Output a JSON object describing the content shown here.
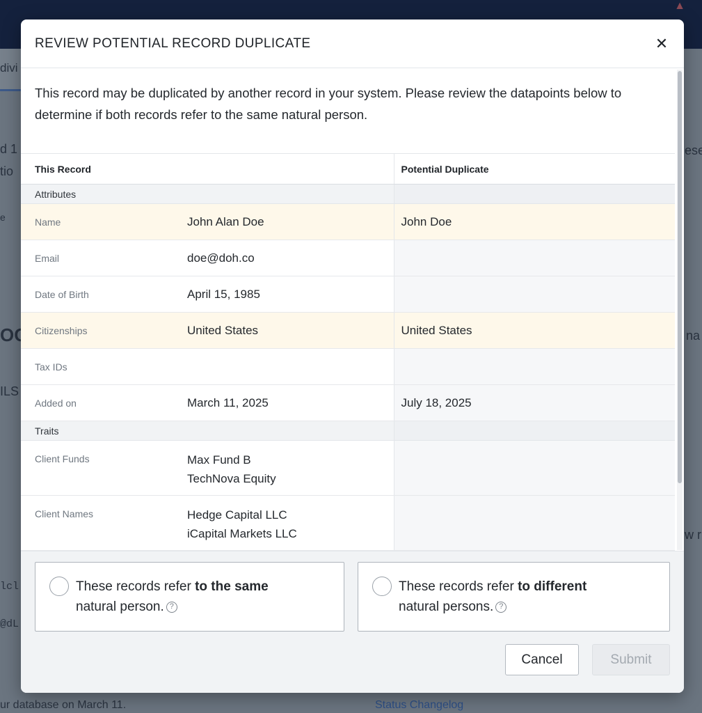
{
  "background": {
    "alert_icon": "warning-icon",
    "fragments": {
      "tab": "divi",
      "summary_1a": "d 1",
      "summary_1b": "tio",
      "right_cut_1": "ese",
      "left_cut_e": "e",
      "big_initials": "OO",
      "right_cut_2": "na",
      "section_cut": "ILS",
      "right_cut_3": "w r",
      "code_1": "lcl",
      "code_2": "@dL",
      "bottom_note": "ur database on March 11.",
      "status_changelog": "Status Changelog"
    }
  },
  "modal": {
    "title": "REVIEW POTENTIAL RECORD DUPLICATE",
    "close_icon": "close-icon",
    "intro": "This record may be duplicated by another record in your system. Please review the datapoints below to determine if both records refer to the same natural person.",
    "table": {
      "this_record_header": "This Record",
      "duplicate_header": "Potential Duplicate",
      "sections": {
        "attributes": "Attributes",
        "traits": "Traits"
      },
      "rows": [
        {
          "label": "Name",
          "this": "John Alan Doe",
          "dup": "John Doe",
          "match": true
        },
        {
          "label": "Email",
          "this": "doe@doh.co",
          "dup": "",
          "match": false
        },
        {
          "label": "Date of Birth",
          "this": "April 15, 1985",
          "dup": "",
          "match": false
        },
        {
          "label": "Citizenships",
          "this": "United States",
          "dup": "United States",
          "match": true
        },
        {
          "label": "Tax IDs",
          "this": "",
          "dup": "",
          "match": false
        },
        {
          "label": "Added on",
          "this": "March 11, 2025",
          "dup": "July 18, 2025",
          "match": false
        }
      ],
      "trait_rows": [
        {
          "label": "Client Funds",
          "this_line1": "Max Fund B",
          "this_line2": "TechNova Equity",
          "dup": ""
        },
        {
          "label": "Client Names",
          "this_line1": "Hedge Capital LLC",
          "this_line2": "iCapital Markets LLC",
          "dup": ""
        }
      ]
    },
    "choices": {
      "same_prefix": "These records refer ",
      "same_bold": "to the same",
      "same_suffix": "natural person.",
      "diff_prefix": "These records refer ",
      "diff_bold": "to different",
      "diff_suffix": "natural persons.",
      "help_icon": "help-circle-icon",
      "help_glyph": "?"
    },
    "buttons": {
      "cancel": "Cancel",
      "submit": "Submit"
    }
  }
}
